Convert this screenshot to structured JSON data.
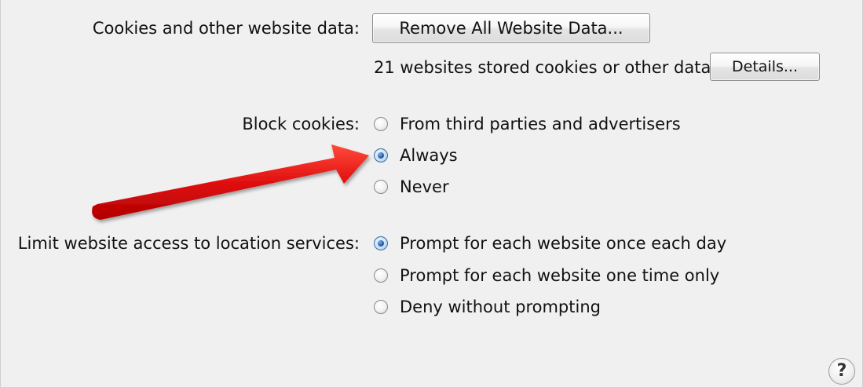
{
  "cookies": {
    "label": "Cookies and other website data:",
    "remove_button": "Remove All Website Data...",
    "stored_text": "21 websites stored cookies or other data",
    "details_button": "Details..."
  },
  "block_cookies": {
    "label": "Block cookies:",
    "options": [
      {
        "label": "From third parties and advertisers",
        "checked": false
      },
      {
        "label": "Always",
        "checked": true
      },
      {
        "label": "Never",
        "checked": false
      }
    ]
  },
  "location": {
    "label": "Limit website access to location services:",
    "options": [
      {
        "label": "Prompt for each website once each day",
        "checked": true
      },
      {
        "label": "Prompt for each website one time only",
        "checked": false
      },
      {
        "label": "Deny without prompting",
        "checked": false
      }
    ]
  },
  "help": {
    "label": "?"
  },
  "annotation": {
    "arrow_color": "#e01010"
  }
}
